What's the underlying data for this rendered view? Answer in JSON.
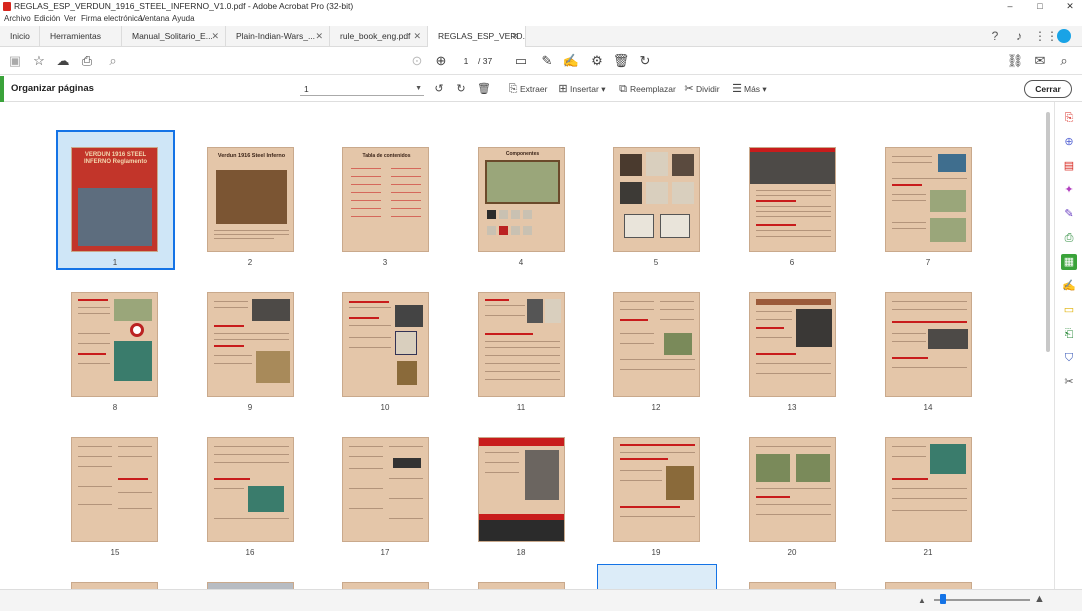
{
  "window": {
    "title": "REGLAS_ESP_VERDUN_1916_STEEL_INFERNO_V1.0.pdf - Adobe Acrobat Pro (32-bit)",
    "minimize": "–",
    "maximize": "□",
    "close": "✕"
  },
  "menu": [
    "Archivo",
    "Edición",
    "Ver",
    "Firma electrónica",
    "Ventana",
    "Ayuda"
  ],
  "tabs": [
    {
      "label": "Inicio"
    },
    {
      "label": "Herramientas"
    },
    {
      "label": "Manual_Solitario_E...",
      "close": "✕"
    },
    {
      "label": "Plain-Indian-Wars_...",
      "close": "✕"
    },
    {
      "label": "rule_book_eng.pdf",
      "close": "✕"
    },
    {
      "label": "REGLAS_ESP_VERD...",
      "close": "✕"
    }
  ],
  "toolbar": {
    "page_current": "1",
    "page_total": "/ 37"
  },
  "organize": {
    "title": "Organizar páginas",
    "page_select": "1",
    "extract": "Extraer",
    "insert": "Insertar",
    "replace": "Reemplazar",
    "split": "Dividir",
    "more": "Más",
    "close": "Cerrar"
  },
  "pages": [
    "1",
    "2",
    "3",
    "4",
    "5",
    "6",
    "7",
    "8",
    "9",
    "10",
    "11",
    "12",
    "13",
    "14",
    "15",
    "16",
    "17",
    "18",
    "19",
    "20",
    "21"
  ],
  "thumb_text": {
    "p1": "VERDUN 1916 STEEL INFERNO Reglamento",
    "p2": "Verdun 1916 Steel Inferno",
    "p3": "Tabla de contenidos",
    "p4": "Componentes"
  },
  "colors": {
    "accent": "#1473e6",
    "organize_green": "#3aa33a",
    "parchment": "#e4c6a9",
    "header_red": "#c81c1c"
  }
}
